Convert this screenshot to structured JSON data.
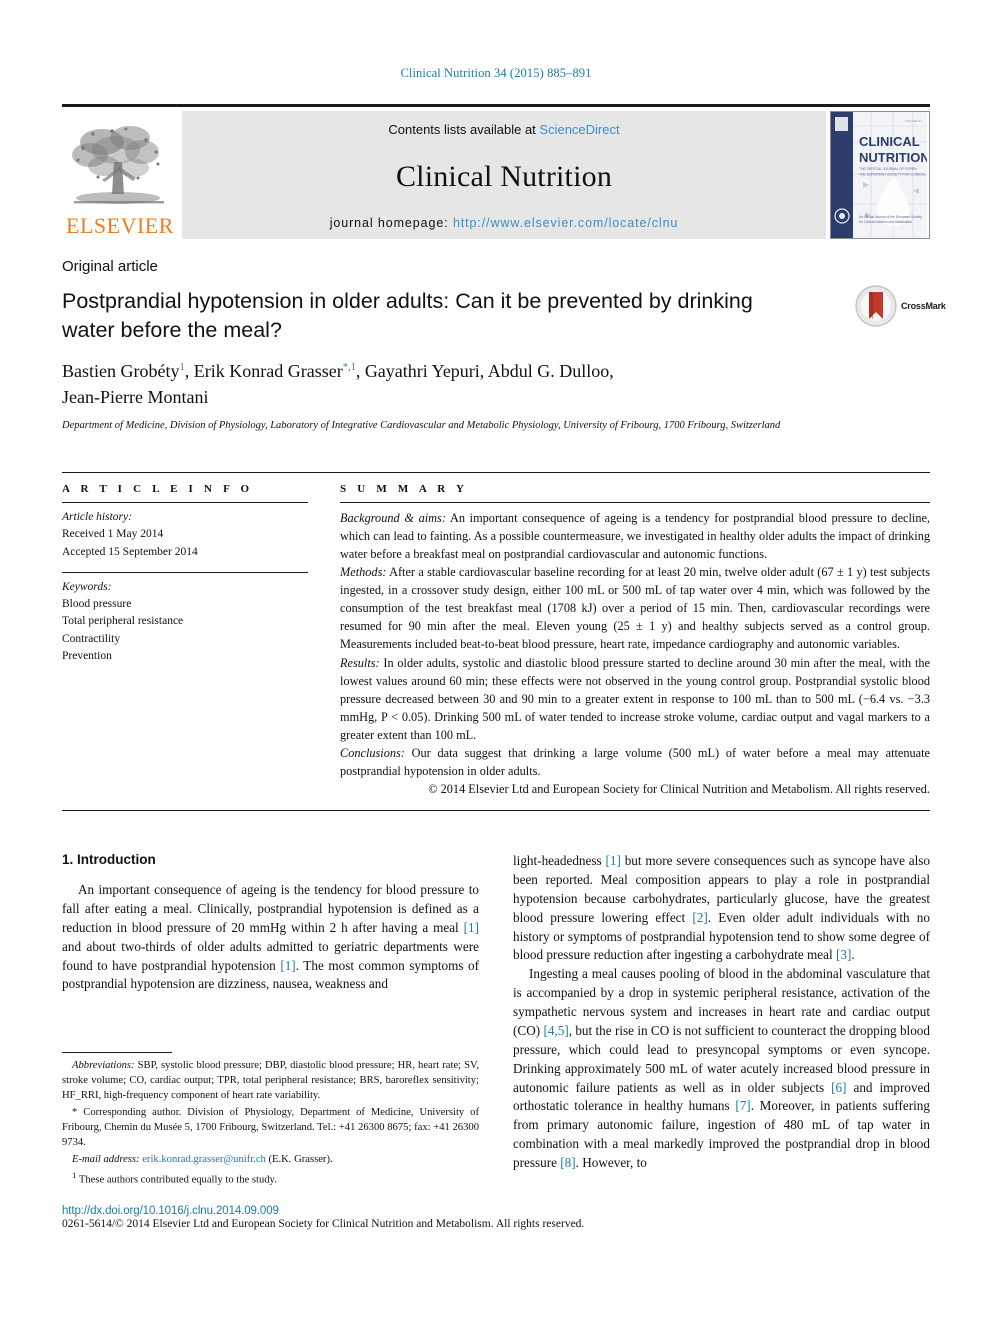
{
  "running_head": "Clinical Nutrition 34 (2015) 885–891",
  "masthead": {
    "publisher_name": "ELSEVIER",
    "contents_prefix": "Contents lists available at ",
    "contents_link": "ScienceDirect",
    "journal_name": "Clinical Nutrition",
    "homepage_label": "journal homepage:",
    "homepage_url": "http://www.elsevier.com/locate/clnu",
    "cover": {
      "line1": "CLINICAL",
      "line2": "NUTRITION",
      "sub1": "THE OFFICIAL JOURNAL OF ESPEN",
      "sub2": "THE EUROPEAN SOCIETY FOR CLINICAL NUTRITION AND METABOLISM",
      "footer1": "An Official Journal of the European Society",
      "footer2": "for Clinical Nutrition and Metabolism"
    }
  },
  "article_type": "Original article",
  "title": "Postprandial hypotension in older adults: Can it be prevented by drinking water before the meal?",
  "crossmark_label": "CrossMark",
  "authors_line1_a": "Bastien Grobéty",
  "authors_line1_b": ", Erik Konrad Grasser",
  "authors_line1_c": ", Gayathri Yepuri, Abdul G. Dulloo,",
  "authors_line2": "Jean-Pierre Montani",
  "affiliation": "Department of Medicine, Division of Physiology, Laboratory of Integrative Cardiovascular and Metabolic Physiology, University of Fribourg, 1700 Fribourg, Switzerland",
  "article_info": {
    "heading": "A R T I C L E   I N F O",
    "history_label": "Article history:",
    "received": "Received 1 May 2014",
    "accepted": "Accepted 15 September 2014",
    "keywords_label": "Keywords:",
    "keywords": [
      "Blood pressure",
      "Total peripheral resistance",
      "Contractility",
      "Prevention"
    ]
  },
  "summary": {
    "heading": "S U M M A R Y",
    "background_label": "Background & aims:",
    "background_text": " An important consequence of ageing is a tendency for postprandial blood pressure to decline, which can lead to fainting. As a possible countermeasure, we investigated in healthy older adults the impact of drinking water before a breakfast meal on postprandial cardiovascular and autonomic functions.",
    "methods_label": "Methods:",
    "methods_text": " After a stable cardiovascular baseline recording for at least 20 min, twelve older adult (67 ± 1 y) test subjects ingested, in a crossover study design, either 100 mL or 500 mL of tap water over 4 min, which was followed by the consumption of the test breakfast meal (1708 kJ) over a period of 15 min. Then, cardiovascular recordings were resumed for 90 min after the meal. Eleven young (25 ± 1 y) and healthy subjects served as a control group. Measurements included beat-to-beat blood pressure, heart rate, impedance cardiography and autonomic variables.",
    "results_label": "Results:",
    "results_text": " In older adults, systolic and diastolic blood pressure started to decline around 30 min after the meal, with the lowest values around 60 min; these effects were not observed in the young control group. Postprandial systolic blood pressure decreased between 30 and 90 min to a greater extent in response to 100 mL than to 500 mL (−6.4 vs. −3.3 mmHg, P < 0.05). Drinking 500 mL of water tended to increase stroke volume, cardiac output and vagal markers to a greater extent than 100 mL.",
    "conclusions_label": "Conclusions:",
    "conclusions_text": " Our data suggest that drinking a large volume (500 mL) of water before a meal may attenuate postprandial hypotension in older adults.",
    "copyright": "© 2014 Elsevier Ltd and European Society for Clinical Nutrition and Metabolism. All rights reserved."
  },
  "introduction": {
    "heading": "1.  Introduction",
    "para1_part1": "An important consequence of ageing is the tendency for blood pressure to fall after eating a meal. Clinically, postprandial hypotension is defined as a reduction in blood pressure of 20 mmHg within 2 h after having a meal ",
    "ref1a": "[1]",
    "para1_part2": " and about two-thirds of older adults admitted to geriatric departments were found to have postprandial hypotension ",
    "ref1b": "[1]",
    "para1_part3": ". The most common symptoms of postprandial hypotension are dizziness, nausea, weakness and",
    "right_para1_part1": "light-headedness ",
    "right_ref1": "[1]",
    "right_para1_part2": " but more severe consequences such as syncope have also been reported. Meal composition appears to play a role in postprandial hypotension because carbohydrates, particularly glucose, have the greatest blood pressure lowering effect ",
    "right_ref2": "[2]",
    "right_para1_part3": ". Even older adult individuals with no history or symptoms of postprandial hypotension tend to show some degree of blood pressure reduction after ingesting a carbohydrate meal ",
    "right_ref3": "[3]",
    "right_para1_part4": ".",
    "right_para2_part1": "Ingesting a meal causes pooling of blood in the abdominal vasculature that is accompanied by a drop in systemic peripheral resistance, activation of the sympathetic nervous system and increases in heart rate and cardiac output (CO) ",
    "right_ref45": "[4,5]",
    "right_para2_part2": ", but the rise in CO is not sufficient to counteract the dropping blood pressure, which could lead to presyncopal symptoms or even syncope. Drinking approximately 500 mL of water acutely increased blood pressure in autonomic failure patients as well as in older subjects ",
    "right_ref6": "[6]",
    "right_para2_part3": " and improved orthostatic tolerance in healthy humans ",
    "right_ref7": "[7]",
    "right_para2_part4": ". Moreover, in patients suffering from primary autonomic failure, ingestion of 480 mL of tap water in combination with a meal markedly improved the postprandial drop in blood pressure ",
    "right_ref8": "[8]",
    "right_para2_part5": ". However, to"
  },
  "footnotes": {
    "abbreviations_label": "Abbreviations:",
    "abbreviations_text": " SBP, systolic blood pressure; DBP, diastolic blood pressure; HR, heart rate; SV, stroke volume; CO, cardiac output; TPR, total peripheral resistance; BRS, baroreflex sensitivity; HF_RRI, high-frequency component of heart rate variability.",
    "corresponding_marker": "*",
    "corresponding_text": " Corresponding author. Division of Physiology, Department of Medicine, University of Fribourg, Chemin du Musée 5, 1700 Fribourg, Switzerland. Tel.: +41 26300 8675; fax: +41 26300 9734.",
    "email_label": "E-mail address:",
    "email": "erik.konrad.grasser@unifr.ch",
    "email_owner": " (E.K. Grasser).",
    "equal_marker": "1",
    "equal_text": " These authors contributed equally to the study."
  },
  "footer": {
    "doi": "http://dx.doi.org/10.1016/j.clnu.2014.09.009",
    "copyright": "0261-5614/© 2014 Elsevier Ltd and European Society for Clinical Nutrition and Metabolism. All rights reserved."
  },
  "colors": {
    "link_blue": "#1f7ba6",
    "sciencedirect_blue": "#3e8fc4",
    "elsevier_orange": "#f07c1e",
    "cover_navy": "#2c3d6b",
    "crossmark_red": "#c0392b"
  }
}
